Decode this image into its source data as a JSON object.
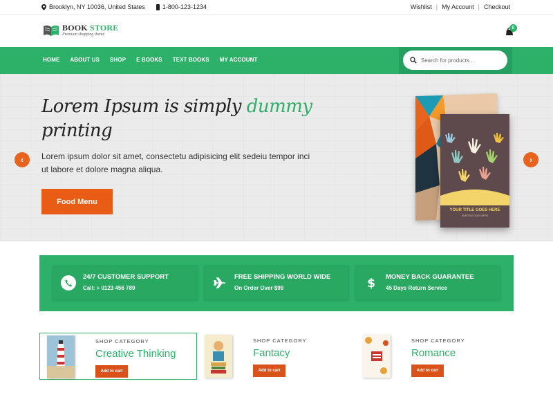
{
  "topbar": {
    "address": "Brooklyn, NY 10036, United States",
    "phone": "1-800-123-1234",
    "links": [
      "Wishlist",
      "My Account",
      "Checkout"
    ]
  },
  "header": {
    "logo_title_1": "BOOK",
    "logo_title_2": "STORE",
    "logo_subtitle": "Premium shopping theme",
    "cart_count": "0"
  },
  "nav": {
    "items": [
      "HOME",
      "ABOUT US",
      "SHOP",
      "E BOOKS",
      "TEXT BOOKS",
      "MY ACCOUNT"
    ],
    "search_placeholder": "Search for products..."
  },
  "hero": {
    "heading_part1": "Lorem Ipsum is simply ",
    "heading_highlight": "dummy",
    "heading_part2": "printing",
    "text": "Lorem ipsum dolor sit amet, consectetu adipisicing elit sedeiu tempor inci ut labore et dolore magna aliqua.",
    "button": "Food Menu",
    "book_title": "YOUR TITLE GOES HERE",
    "book_subtitle": "SUBTITLE GOES HERE",
    "prev_arrow": "‹",
    "next_arrow": "›"
  },
  "features": [
    {
      "title": "24/7 CUSTOMER SUPPORT",
      "subtitle": "Call: + 0123 456 789",
      "icon": "phone-icon"
    },
    {
      "title": "FREE SHIPPING WORLD WIDE",
      "subtitle": "On Order Over $99",
      "icon": "plane-icon"
    },
    {
      "title": "MONEY BACK GUARANTEE",
      "subtitle": "45 Days Return Service",
      "icon": "dollar-icon"
    }
  ],
  "categories": [
    {
      "label": "SHOP CATEGORY",
      "name": "Creative Thinking",
      "button": "Add to cart"
    },
    {
      "label": "SHOP CATEGORY",
      "name": "Fantacy",
      "button": "Add to cart"
    },
    {
      "label": "SHOP CATEGORY",
      "name": "Romance",
      "button": "Add to cart"
    }
  ],
  "colors": {
    "brand_green": "#2db068",
    "accent_orange": "#e85c15"
  }
}
